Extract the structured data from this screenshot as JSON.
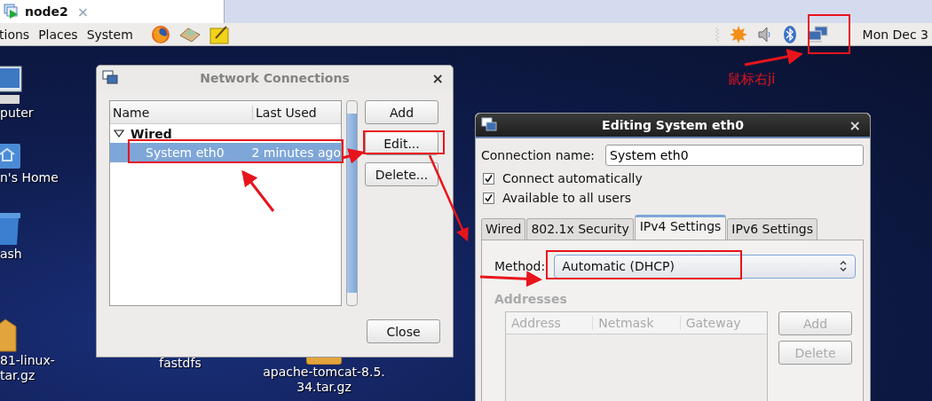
{
  "vm_tab": {
    "title": "node2",
    "close": "×"
  },
  "top_panel": {
    "menus": [
      "tions",
      "Places",
      "System"
    ],
    "clock": "Mon Dec 3"
  },
  "desktop_icons": [
    {
      "kind": "computer",
      "lines": [
        "puter"
      ]
    },
    {
      "kind": "home",
      "lines": [
        "n's Home"
      ]
    },
    {
      "kind": "trash",
      "lines": [
        "ash"
      ]
    },
    {
      "kind": "package",
      "lines": [
        "81-linux-",
        "tar.gz"
      ]
    }
  ],
  "desktop_files": [
    {
      "lines": [
        "fastdfs"
      ]
    },
    {
      "kind": "package",
      "lines": [
        "apache-tomcat-8.5.",
        "34.tar.gz"
      ]
    }
  ],
  "network_connections": {
    "title": "Network Connections",
    "close": "×",
    "columns": [
      "Name",
      "Last Used"
    ],
    "groups": [
      {
        "name": "Wired",
        "expanded": true,
        "children": [
          {
            "name": "System eth0",
            "last_used": "2 minutes ago",
            "selected": true
          }
        ]
      }
    ],
    "buttons": [
      "Add",
      "Edit...",
      "Delete..."
    ],
    "close_button": "Close"
  },
  "editing": {
    "title": "Editing System eth0",
    "close": "×",
    "connection_name_label": "Connection name:",
    "connection_name": "System eth0",
    "options": [
      {
        "label": "Connect automatically",
        "checked": true
      },
      {
        "label": "Available to all users",
        "checked": true
      }
    ],
    "tabs": [
      {
        "label": "Wired",
        "selected": false
      },
      {
        "label": "802.1x Security",
        "selected": false
      },
      {
        "label": "IPv4 Settings",
        "selected": true
      },
      {
        "label": "IPv6 Settings",
        "selected": false
      }
    ],
    "method_label": "Method:",
    "method": "Automatic (DHCP)",
    "addresses_label": "Addresses",
    "address_columns": [
      "Address",
      "Netmask",
      "Gateway"
    ],
    "address_buttons": [
      {
        "label": "Add",
        "disabled": true
      },
      {
        "label": "Delete",
        "disabled": true
      }
    ]
  },
  "annotation": {
    "text": "鼠标右ji"
  }
}
